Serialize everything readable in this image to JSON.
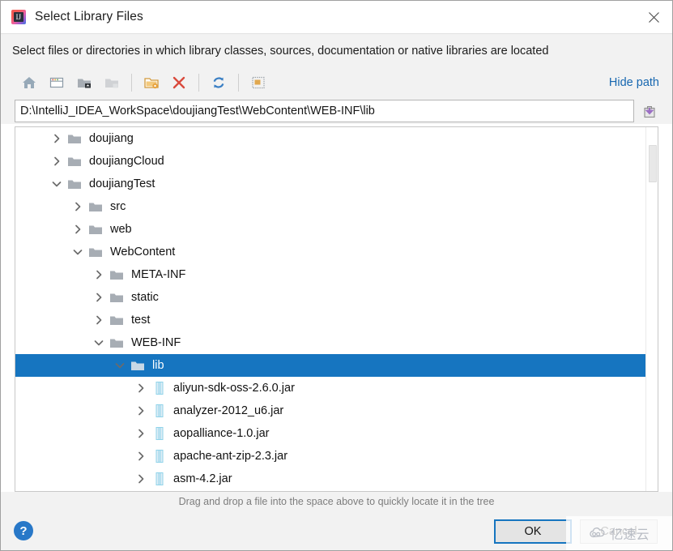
{
  "window": {
    "title": "Select Library Files",
    "app_icon": "intellij-idea-icon",
    "close_icon": "close-icon"
  },
  "instruction": "Select files or directories in which library classes, sources, documentation or native libraries are located",
  "toolbar": {
    "buttons": [
      {
        "name": "home-icon",
        "title": "Home",
        "enabled": true
      },
      {
        "name": "desktop-icon",
        "title": "Desktop",
        "enabled": true
      },
      {
        "name": "folder-up-icon",
        "title": "Up",
        "enabled": true
      },
      {
        "name": "folder-icon",
        "title": "Folder",
        "enabled": false
      },
      {
        "name": "new-folder-icon",
        "title": "New Folder",
        "enabled": true
      },
      {
        "name": "delete-icon",
        "title": "Delete",
        "enabled": true
      },
      {
        "name": "refresh-icon",
        "title": "Refresh",
        "enabled": true
      },
      {
        "name": "show-hidden-icon",
        "title": "Show Hidden Files",
        "enabled": true
      }
    ],
    "hide_path_label": "Hide path"
  },
  "path_field": {
    "value": "D:\\IntelliJ_IDEA_WorkSpace\\doujiangTest\\WebContent\\WEB-INF\\lib",
    "placeholder": "",
    "paste_icon": "paste-path-icon"
  },
  "tree": {
    "rows": [
      {
        "label": "doujiang",
        "indent": 1,
        "type": "folder",
        "state": "collapsed",
        "selected": false
      },
      {
        "label": "doujiangCloud",
        "indent": 1,
        "type": "folder",
        "state": "collapsed",
        "selected": false
      },
      {
        "label": "doujiangTest",
        "indent": 1,
        "type": "folder",
        "state": "expanded",
        "selected": false
      },
      {
        "label": "src",
        "indent": 2,
        "type": "folder",
        "state": "collapsed",
        "selected": false
      },
      {
        "label": "web",
        "indent": 2,
        "type": "folder",
        "state": "collapsed",
        "selected": false
      },
      {
        "label": "WebContent",
        "indent": 2,
        "type": "folder",
        "state": "expanded",
        "selected": false
      },
      {
        "label": "META-INF",
        "indent": 3,
        "type": "folder",
        "state": "collapsed",
        "selected": false
      },
      {
        "label": "static",
        "indent": 3,
        "type": "folder",
        "state": "collapsed",
        "selected": false
      },
      {
        "label": "test",
        "indent": 3,
        "type": "folder",
        "state": "collapsed",
        "selected": false
      },
      {
        "label": "WEB-INF",
        "indent": 3,
        "type": "folder",
        "state": "expanded",
        "selected": false
      },
      {
        "label": "lib",
        "indent": 4,
        "type": "folder",
        "state": "expanded",
        "selected": true
      },
      {
        "label": "aliyun-sdk-oss-2.6.0.jar",
        "indent": 5,
        "type": "jar",
        "state": "collapsed",
        "selected": false
      },
      {
        "label": "analyzer-2012_u6.jar",
        "indent": 5,
        "type": "jar",
        "state": "collapsed",
        "selected": false
      },
      {
        "label": "aopalliance-1.0.jar",
        "indent": 5,
        "type": "jar",
        "state": "collapsed",
        "selected": false
      },
      {
        "label": "apache-ant-zip-2.3.jar",
        "indent": 5,
        "type": "jar",
        "state": "collapsed",
        "selected": false
      },
      {
        "label": "asm-4.2.jar",
        "indent": 5,
        "type": "jar",
        "state": "collapsed",
        "selected": false
      }
    ],
    "scrollbar": {
      "name": "vertical-scrollbar"
    }
  },
  "hint": "Drag and drop a file into the space above to quickly locate it in the tree",
  "footer": {
    "help_label": "?",
    "ok_label": "OK",
    "cancel_label": "Cancel"
  },
  "watermark": {
    "text": "亿速云",
    "icon": "cloud-icon"
  },
  "colors": {
    "selection_blue": "#1675c0",
    "link_blue": "#1767b0",
    "panel_gray": "#f2f2f2",
    "folder_gray": "#a7adb4",
    "jar_blue": "#8fd3ea",
    "delete_red": "#d94a3d",
    "new_folder_orange": "#e8a33d",
    "paste_purple": "#9b6fc4"
  }
}
